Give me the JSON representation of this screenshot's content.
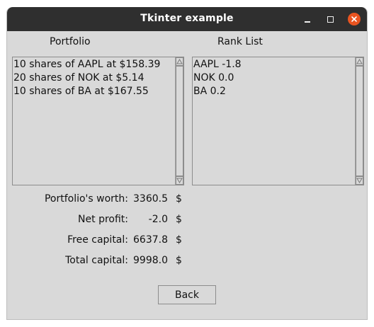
{
  "window": {
    "title": "Tkinter example"
  },
  "portfolio": {
    "header": "Portfolio",
    "items": [
      "10 shares of AAPL at $158.39",
      "20 shares of NOK at $5.14",
      "10 shares of BA at $167.55"
    ]
  },
  "ranklist": {
    "header": "Rank List",
    "items": [
      "AAPL -1.8",
      "NOK 0.0",
      "BA 0.2"
    ]
  },
  "stats": [
    {
      "label": "Portfolio's worth:",
      "value": "3360.5",
      "unit": "$"
    },
    {
      "label": "Net profit:",
      "value": "-2.0",
      "unit": "$"
    },
    {
      "label": "Free capital:",
      "value": "6637.8",
      "unit": "$"
    },
    {
      "label": "Total capital:",
      "value": "9998.0",
      "unit": "$"
    }
  ],
  "buttons": {
    "back_label": "Back"
  },
  "colors": {
    "titlebar": "#2f2f2f",
    "close_button": "#e95420",
    "window_bg": "#d9d9d9"
  },
  "icons": {
    "minimize": "minimize-icon",
    "maximize": "maximize-icon",
    "close": "close-icon",
    "scroll_up": "arrow-up-icon",
    "scroll_down": "arrow-down-icon"
  }
}
